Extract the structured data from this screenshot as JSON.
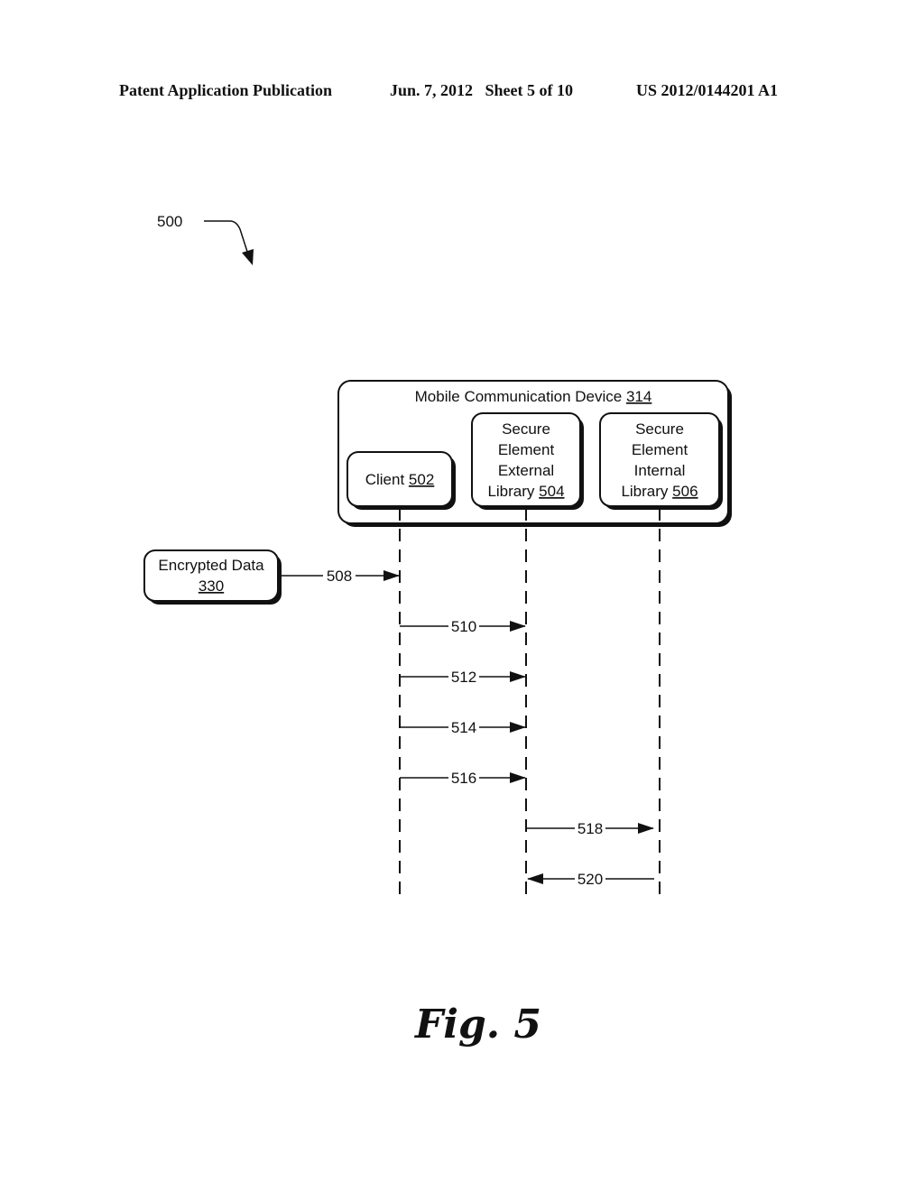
{
  "header": {
    "publication": "Patent Application Publication",
    "date_sheet": "Jun. 7, 2012   Sheet 5 of 10",
    "patent_number": "US 2012/0144201 A1"
  },
  "figure": {
    "ref_number": "500",
    "caption": "Fig. 5"
  },
  "container": {
    "label": "Mobile Communication Device",
    "ref": "314"
  },
  "participants": [
    {
      "lines": [
        "Client"
      ],
      "ref": "502"
    },
    {
      "lines": [
        "Secure",
        "Element",
        "External",
        "Library"
      ],
      "ref": "504"
    },
    {
      "lines": [
        "Secure",
        "Element",
        "Internal",
        "Library"
      ],
      "ref": "506"
    }
  ],
  "external_source": {
    "label": "Encrypted Data",
    "ref": "330"
  },
  "messages": [
    {
      "label": "508",
      "from": "external",
      "to": "502"
    },
    {
      "label": "510",
      "from": "502",
      "to": "504"
    },
    {
      "label": "512",
      "from": "502",
      "to": "504"
    },
    {
      "label": "514",
      "from": "502",
      "to": "504"
    },
    {
      "label": "516",
      "from": "502",
      "to": "504"
    },
    {
      "label": "518",
      "from": "504",
      "to": "506"
    },
    {
      "label": "520",
      "from": "506",
      "to": "504"
    }
  ]
}
